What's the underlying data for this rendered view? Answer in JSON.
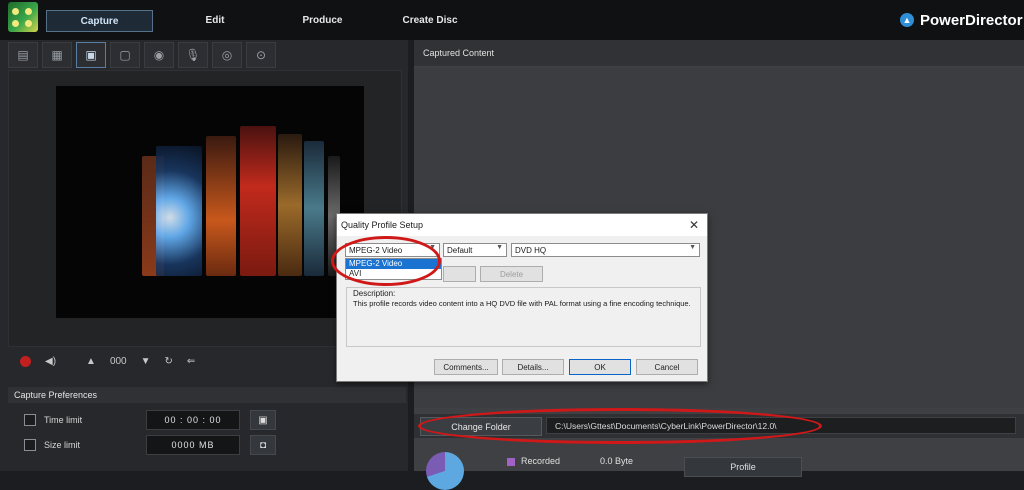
{
  "header": {
    "tabs": [
      {
        "label": "Capture",
        "active": true
      },
      {
        "label": "Edit"
      },
      {
        "label": "Produce"
      },
      {
        "label": "Create Disc"
      }
    ],
    "brand": "PowerDirector"
  },
  "right_panel": {
    "title": "Captured Content"
  },
  "transport": {
    "counter": "000"
  },
  "capture_prefs": {
    "title": "Capture Preferences",
    "time_limit": {
      "label": "Time limit",
      "value": "00 : 00 : 00"
    },
    "size_limit": {
      "label": "Size limit",
      "value": "0000   MB"
    }
  },
  "folder": {
    "button": "Change Folder",
    "path": "C:\\Users\\Gttest\\Documents\\CyberLink\\PowerDirector\\12.0\\"
  },
  "disk_info": {
    "recorded_label": "Recorded",
    "recorded_value": "0.0  Byte",
    "profile_button": "Profile"
  },
  "dialog": {
    "title": "Quality Profile Setup",
    "format_selected": "MPEG-2 Video",
    "format_options": [
      "MPEG-2 Video",
      "AVI"
    ],
    "profile_type": "Default",
    "quality": "DVD HQ",
    "delete_button": "Delete",
    "description_label": "Description:",
    "description": "This profile records video content into a HQ DVD file with PAL format using a fine encoding technique.",
    "buttons": {
      "comments": "Comments...",
      "details": "Details...",
      "ok": "OK",
      "cancel": "Cancel"
    }
  },
  "colors": {
    "highlight": "#d01818",
    "selection": "#1a73d1",
    "record": "#c21f1f"
  }
}
